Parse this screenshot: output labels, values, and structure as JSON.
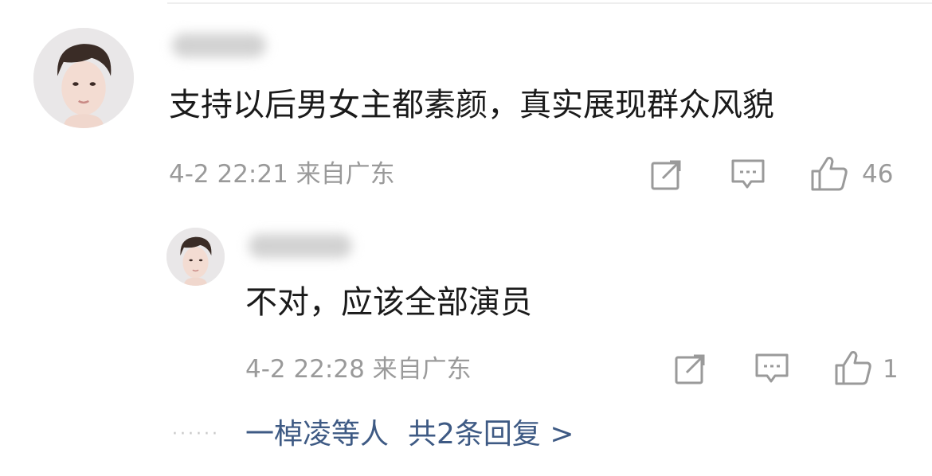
{
  "comment": {
    "text": "支持以后男女主都素颜，真实展现群众风貌",
    "timestamp": "4-2 22:21 来自广东",
    "like_count": "46",
    "icons": {
      "repost": "repost-icon",
      "reply": "comment-icon",
      "like": "thumbs-up-icon"
    }
  },
  "reply": {
    "text": "不对，应该全部演员",
    "timestamp": "4-2 22:28 来自广东",
    "like_count": "1"
  },
  "reply_summary": {
    "dots": "······",
    "users": "一棹凌等人",
    "count_text": "共2条回复 >"
  },
  "colors": {
    "link": "#3e5a84",
    "meta": "#9a9a9a",
    "text": "#1a1a1a"
  }
}
